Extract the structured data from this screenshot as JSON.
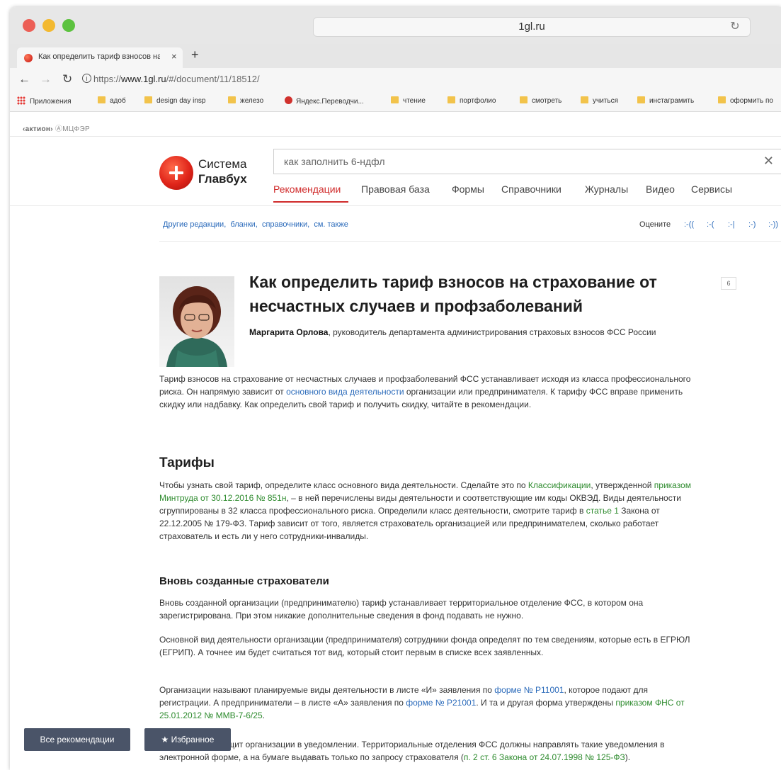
{
  "browser": {
    "window_title": "1gl.ru",
    "tab": {
      "title": "Как определить тариф взносов на страхование",
      "close": "×"
    },
    "new_tab": "+",
    "url_scheme": "https://",
    "url_domain": "www.1gl.ru",
    "url_path": "/#/document/11/18512/",
    "bookmarks": [
      "Приложения",
      "адоб",
      "design day insp",
      "железо",
      "Яндекс.Переводчи...",
      "чтение",
      "портфолио",
      "смотреть",
      "учиться",
      "инстаграмить",
      "оформить по"
    ]
  },
  "topbar": {
    "aktion": "‹актион›",
    "mcfer": "МЦФЭР"
  },
  "header": {
    "brand_line1": "Система",
    "brand_line2": "Главбух",
    "search_value": "как заполнить 6-ндфл",
    "nav": [
      "Рекомендации",
      "Правовая база",
      "Формы",
      "Справочники",
      "Журналы",
      "Видео",
      "Сервисы"
    ],
    "active_nav": "Рекомендации"
  },
  "subnav": {
    "links": [
      "Другие редакции,",
      "бланки,",
      "справочники,",
      "см. также"
    ],
    "rate_label": "Оцените",
    "rate_options": [
      ":-((",
      ":-(",
      ":-|",
      ":-)",
      ":-))"
    ]
  },
  "article": {
    "title": "Как определить тариф взносов на страхование от несчастных случаев и профзаболеваний",
    "badge": "6",
    "author_name": "Маргарита Орлова",
    "author_role": ", руководитель департамента администрирования страховых взносов ФСС России",
    "intro_1": "Тариф взносов на страхование от несчастных случаев и профзаболеваний ФСС устанавливает исходя из класса профессионального риска. Он напрямую зависит от ",
    "intro_link": "основного вида деятельности",
    "intro_2": " организации или предпринимателя. К тарифу ФСС вправе применить скидку или надбавку. Как определить свой тариф и получить скидку, читайте в рекомендации.",
    "h_tariffs": "Тарифы",
    "t_1": "Чтобы узнать свой тариф, определите класс основного вида деятельности. Сделайте это по ",
    "t_link1": "Классификации",
    "t_2": ", утвержденной ",
    "t_link2": "приказом Минтруда от 30.12.2016 № 851н",
    "t_3": ", – в ней перечислены виды деятельности и соответствующие им коды ОКВЭД. Виды деятельности сгруппированы в 32 класса профессионального риска. Определили класс деятельности, смотрите тариф в ",
    "t_link3": "статье 1",
    "t_4": " Закона от 22.12.2005 № 179-ФЗ. Тариф зависит от того, является страхователь организацией или предпринимателем, сколько работает страхователь и есть ли у него сотрудники-инвалиды.",
    "h_new": "Вновь созданные страхователи",
    "n_p1": "Вновь созданной организации (предпринимателю) тариф устанавливает территориальное отделение ФСС, в котором она зарегистрирована. При этом никакие дополнительные сведения в фонд подавать не нужно.",
    "n_p2": "Основной вид деятельности организации (предпринимателя) сотрудники фонда определят по тем сведениям, которые есть в ЕГРЮЛ (ЕГРИП). А точнее им будет считаться тот вид, который стоит первым в списке всех заявленных.",
    "n_p3_1": "Организации называют планируемые виды деятельности в листе «И» заявления по ",
    "n_p3_link1": "форме № Р11001",
    "n_p3_2": ", которое подают для регистрации. А предприниматели – в листе «А» заявления по ",
    "n_p3_link2": "форме № Р21001",
    "n_p3_3": ". И та и другая форма утверждены ",
    "n_p3_link3": "приказом ФНС от 25.01.2012 № ММВ-7-6/25",
    "n_p3_4": ".",
    "n_p4_1": "Тариф ФСС сообщит организации в уведомлении. Территориальные отделения ФСС должны направлять такие уведомления в электронной форме, а на бумаге выдавать только по запросу страхователя (",
    "n_p4_link": "п. 2 ст. 6 Закона от 24.07.1998 № 125-ФЗ",
    "n_p4_2": ")."
  },
  "bottom_buttons": {
    "all_recs": "Все рекомендации",
    "favorites": "Избранное"
  },
  "colors": {
    "accent": "#d02b2b",
    "link": "#2a6aba",
    "legal_link": "#2e8b2e",
    "button": "#4a5468"
  }
}
